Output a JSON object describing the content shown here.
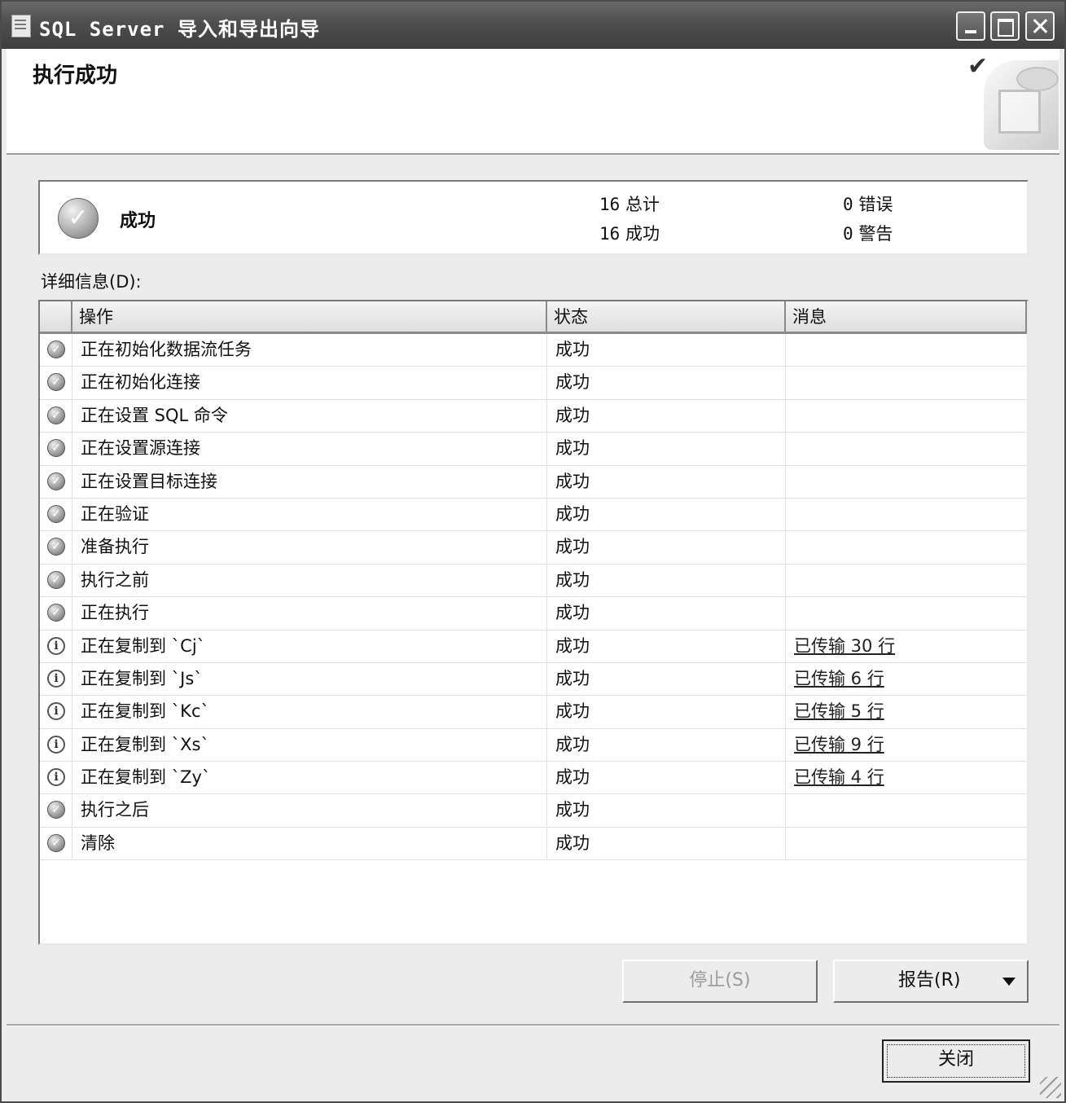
{
  "window": {
    "title": "SQL Server 导入和导出向导"
  },
  "header": {
    "title": "执行成功"
  },
  "summary": {
    "status": "成功",
    "total_count": "16",
    "total_label": "总计",
    "success_count": "16",
    "success_label": "成功",
    "error_count": "0",
    "error_label": "错误",
    "warning_count": "0",
    "warning_label": "警告"
  },
  "details": {
    "label": "详细信息(D):",
    "columns": [
      "操作",
      "状态",
      "消息"
    ],
    "rows": [
      {
        "icon": "success-icon",
        "op": "正在初始化数据流任务",
        "status": "成功",
        "message": ""
      },
      {
        "icon": "success-icon",
        "op": "正在初始化连接",
        "status": "成功",
        "message": ""
      },
      {
        "icon": "success-icon",
        "op": "正在设置 SQL 命令",
        "status": "成功",
        "message": ""
      },
      {
        "icon": "success-icon",
        "op": "正在设置源连接",
        "status": "成功",
        "message": ""
      },
      {
        "icon": "success-icon",
        "op": "正在设置目标连接",
        "status": "成功",
        "message": ""
      },
      {
        "icon": "success-icon",
        "op": "正在验证",
        "status": "成功",
        "message": ""
      },
      {
        "icon": "success-icon",
        "op": "准备执行",
        "status": "成功",
        "message": ""
      },
      {
        "icon": "success-icon",
        "op": "执行之前",
        "status": "成功",
        "message": ""
      },
      {
        "icon": "success-icon",
        "op": "正在执行",
        "status": "成功",
        "message": ""
      },
      {
        "icon": "info-icon",
        "op": "正在复制到 `Cj`",
        "status": "成功",
        "message": "已传输 30 行"
      },
      {
        "icon": "info-icon",
        "op": "正在复制到 `Js`",
        "status": "成功",
        "message": "已传输 6 行"
      },
      {
        "icon": "info-icon",
        "op": "正在复制到 `Kc`",
        "status": "成功",
        "message": "已传输 5 行"
      },
      {
        "icon": "info-icon",
        "op": "正在复制到 `Xs`",
        "status": "成功",
        "message": "已传输 9 行"
      },
      {
        "icon": "info-icon",
        "op": "正在复制到 `Zy`",
        "status": "成功",
        "message": "已传输 4 行"
      },
      {
        "icon": "success-icon",
        "op": "执行之后",
        "status": "成功",
        "message": ""
      },
      {
        "icon": "success-icon",
        "op": "清除",
        "status": "成功",
        "message": ""
      }
    ]
  },
  "buttons": {
    "stop": "停止(S)",
    "report": "报告(R)",
    "close": "关闭"
  }
}
